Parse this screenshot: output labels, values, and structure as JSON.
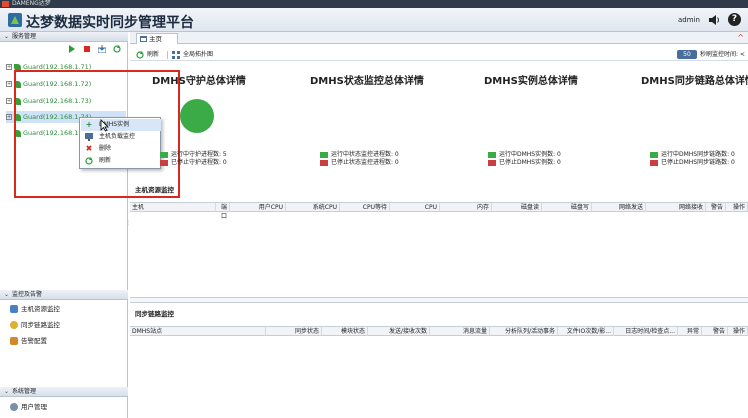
{
  "window": {
    "title": "DAMENG达梦"
  },
  "header": {
    "title": "达梦数据实时同步管理平台",
    "user": "admin",
    "volume_icon": "speaker-icon",
    "help_label": "?"
  },
  "sidebar": {
    "service_panel": {
      "label": "服务管理",
      "chevron": "⌄"
    },
    "tree": [
      {
        "expander": "+",
        "label": "Guard(192.168.1.71)"
      },
      {
        "expander": "+",
        "label": "Guard(192.168.1.72)"
      },
      {
        "expander": "+",
        "label": "Guard(192.168.1.73)"
      },
      {
        "expander": "+",
        "label": "Guard(192.168.1.74)"
      },
      {
        "expander": "",
        "label": "Guard(192.168.1"
      }
    ],
    "monitor_panel": {
      "label": "监控及告警",
      "chevron": "⌄"
    },
    "monitor_items": [
      {
        "label": "主机资源监控",
        "color": "#4a7fc1"
      },
      {
        "label": "同步链路监控",
        "color": "#e0b030"
      },
      {
        "label": "告警配置",
        "color": "#d08a2a"
      }
    ],
    "system_panel": {
      "label": "系统管理",
      "chevron": "⌄"
    },
    "system_items": [
      {
        "label": "用户管理"
      }
    ]
  },
  "context_menu": {
    "items": [
      {
        "label": "DMHS实例",
        "icon": "plus-icon",
        "color": "#2a8c3a"
      },
      {
        "label": "主机负载监控",
        "icon": "monitor-icon",
        "color": "#555555"
      },
      {
        "label": "删除",
        "icon": "delete-icon",
        "color": "#d9291e"
      },
      {
        "label": "刷新",
        "icon": "refresh-icon",
        "color": "#2a8c3a"
      }
    ]
  },
  "main": {
    "tab": {
      "label": "主页"
    },
    "toolbar": {
      "refresh_label": "刷新",
      "topology_label": "全局拓扑图",
      "interval_value": "50",
      "interval_label": "秒刷监控时间: <"
    },
    "summaries": [
      {
        "title": "DMHS守护总体详情",
        "running": "运行中守护进程数: 5",
        "stopped": "已停止守护进程数: 0"
      },
      {
        "title": "DMHS状态监控总体详情",
        "running": "运行中状态监控进程数: 0",
        "stopped": "已停止状态监控进程数: 0"
      },
      {
        "title": "DMHS实例总体详情",
        "running": "运行中DMHS实例数: 0",
        "stopped": "已停止DMHS实例数: 0"
      },
      {
        "title": "DMHS同步链路总体详情",
        "running": "运行中DMHS同步链路数: 0",
        "stopped": "已停止DMHS同步链路数: 0"
      }
    ],
    "status_colors": {
      "running": "#3bab47",
      "stopped": "#c94040"
    },
    "host_monitor": {
      "title": "主机资源监控",
      "columns": [
        "主机",
        "端口",
        "用户CPU",
        "系统CPU",
        "CPU等待",
        "CPU",
        "内存",
        "磁盘读",
        "磁盘写",
        "网络发送",
        "网络接收",
        "警告",
        "操作"
      ]
    },
    "link_monitor": {
      "title": "同步链路监控",
      "columns": [
        "DMHS站点",
        "同步状态",
        "模块状态",
        "发送/接收次数",
        "消息流量",
        "分析队列/活动事务",
        "文件IO次数/影...",
        "日志时间/检查点...",
        "异常",
        "警告",
        "操作"
      ]
    }
  }
}
